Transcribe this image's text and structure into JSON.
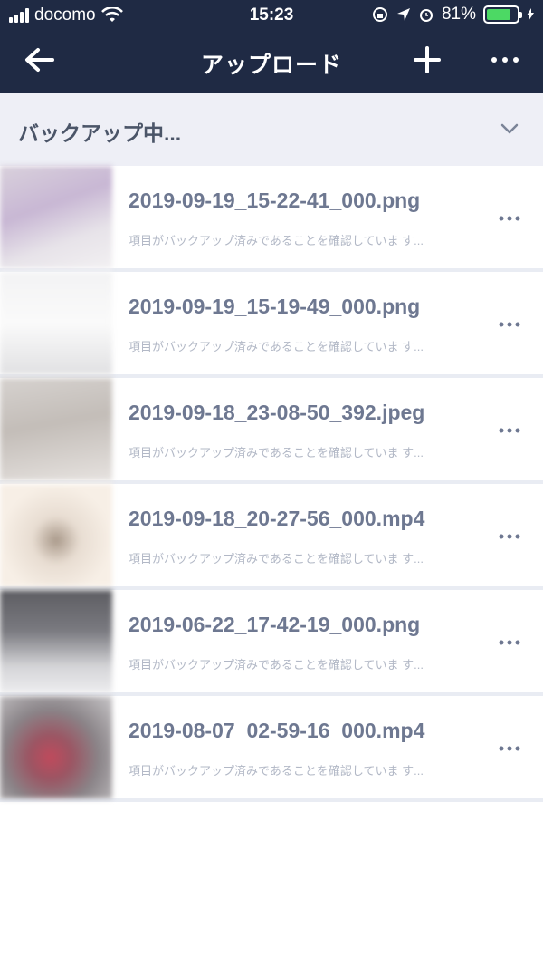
{
  "status": {
    "carrier": "docomo",
    "time": "15:23",
    "battery": "81%"
  },
  "nav": {
    "title": "アップロード"
  },
  "section": {
    "label": "バックアップ中..."
  },
  "items": [
    {
      "name": "2019-09-19_15-22-41_000.png",
      "status": "項目がバックアップ済みであることを確認していま す..."
    },
    {
      "name": "2019-09-19_15-19-49_000.png",
      "status": "項目がバックアップ済みであることを確認していま す..."
    },
    {
      "name": "2019-09-18_23-08-50_392.jpeg",
      "status": "項目がバックアップ済みであることを確認していま す..."
    },
    {
      "name": "2019-09-18_20-27-56_000.mp4",
      "status": "項目がバックアップ済みであることを確認していま す..."
    },
    {
      "name": "2019-06-22_17-42-19_000.png",
      "status": "項目がバックアップ済みであることを確認していま す..."
    },
    {
      "name": "2019-08-07_02-59-16_000.mp4",
      "status": "項目がバックアップ済みであることを確認していま す..."
    }
  ],
  "colors": {
    "header": "#1f2a44",
    "accent": "#4cd964",
    "section_bg": "#eeeff6",
    "filename": "#6e7891"
  }
}
